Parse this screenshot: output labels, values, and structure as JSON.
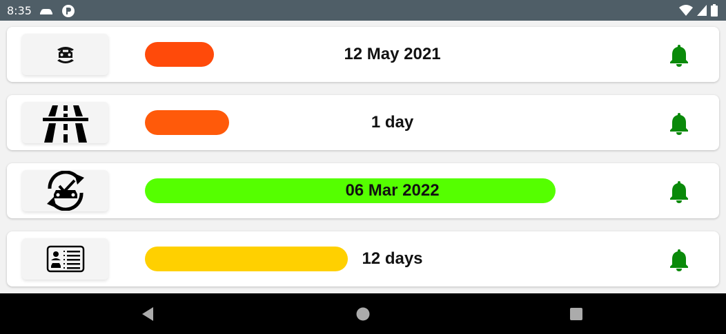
{
  "status_bar": {
    "time": "8:35",
    "left_icons": [
      "car-icon",
      "app-notification-icon"
    ],
    "right_icons": [
      "wifi-icon",
      "signal-icon",
      "battery-icon"
    ]
  },
  "reminders": [
    {
      "icon": "car-insurance-icon",
      "value": "12 May 2021",
      "progress": 0.14,
      "bar_color": "#ff4a0a",
      "notification_icon": "bell-icon"
    },
    {
      "icon": "highway-vignette-icon",
      "value": "1 day",
      "progress": 0.17,
      "bar_color": "#ff5a0a",
      "notification_icon": "bell-icon"
    },
    {
      "icon": "technical-inspection-icon",
      "value": "06 Mar 2022",
      "progress": 0.83,
      "bar_color": "#55ff00",
      "notification_icon": "bell-icon"
    },
    {
      "icon": "driving-license-icon",
      "value": "12 days",
      "progress": 0.41,
      "bar_color": "#ffd000",
      "notification_icon": "bell-icon"
    }
  ],
  "colors": {
    "bell": "#0a8a0a",
    "status_bar": "#4f5e67",
    "nav_bar": "#000000"
  },
  "nav_bar": {
    "buttons": [
      "back-icon",
      "home-icon",
      "recents-icon"
    ]
  }
}
